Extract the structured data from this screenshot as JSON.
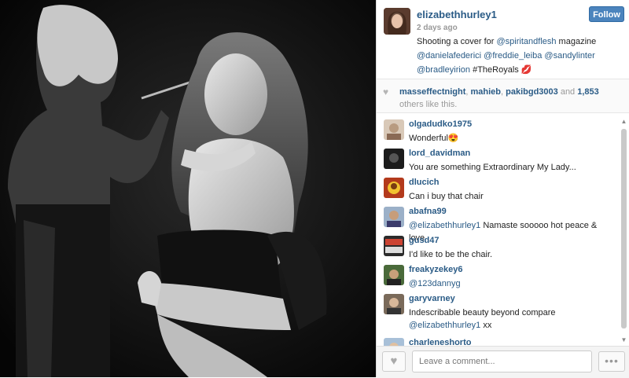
{
  "post": {
    "username": "elizabethhurley1",
    "time_ago": "2 days ago",
    "follow_label": "Follow",
    "caption_parts": {
      "p1": "Shooting a cover for ",
      "m1": "@spiritandflesh",
      "p2": " magazine ",
      "m2": "@danielafederici",
      "p3": " ",
      "m3": "@freddie_leiba",
      "p4": " ",
      "m4": "@sandylinter",
      "p5": " ",
      "m5": "@bradleyirion",
      "p6": " #TheRoyals 💋"
    }
  },
  "likes": {
    "icon": "heart-icon",
    "users": [
      "masseffectnight",
      "mahieb",
      "pakibgd3003"
    ],
    "sep1": ", ",
    "sep2": ", ",
    "and_text": " and ",
    "count": "1,853",
    "suffix": " others like this."
  },
  "comments": [
    {
      "user": "olgadudko1975",
      "text": "Wonderful😍"
    },
    {
      "user": "lord_davidman",
      "text": "You are something Extraordinary My Lady..."
    },
    {
      "user": "dlucich",
      "text": "Can i buy that chair"
    },
    {
      "user": "abafna99",
      "mention": "@elizabethhurley1",
      "text": " Namaste sooooo hot peace & love"
    },
    {
      "user": "gusd47",
      "text": "I'd like to be the chair."
    },
    {
      "user": "freakyzekey6",
      "mention": "@123dannyg",
      "text": ""
    },
    {
      "user": "garyvarney",
      "text": "Indescribable beauty beyond compare",
      "mention2": "@elizabethhurley1",
      "text2": " xx"
    },
    {
      "user": "charleneshorto",
      "text": ""
    }
  ],
  "footer": {
    "comment_placeholder": "Leave a comment...",
    "more_label": "•••"
  },
  "colors": {
    "link": "#2a5b86",
    "follow_bg": "#4b84bd"
  }
}
